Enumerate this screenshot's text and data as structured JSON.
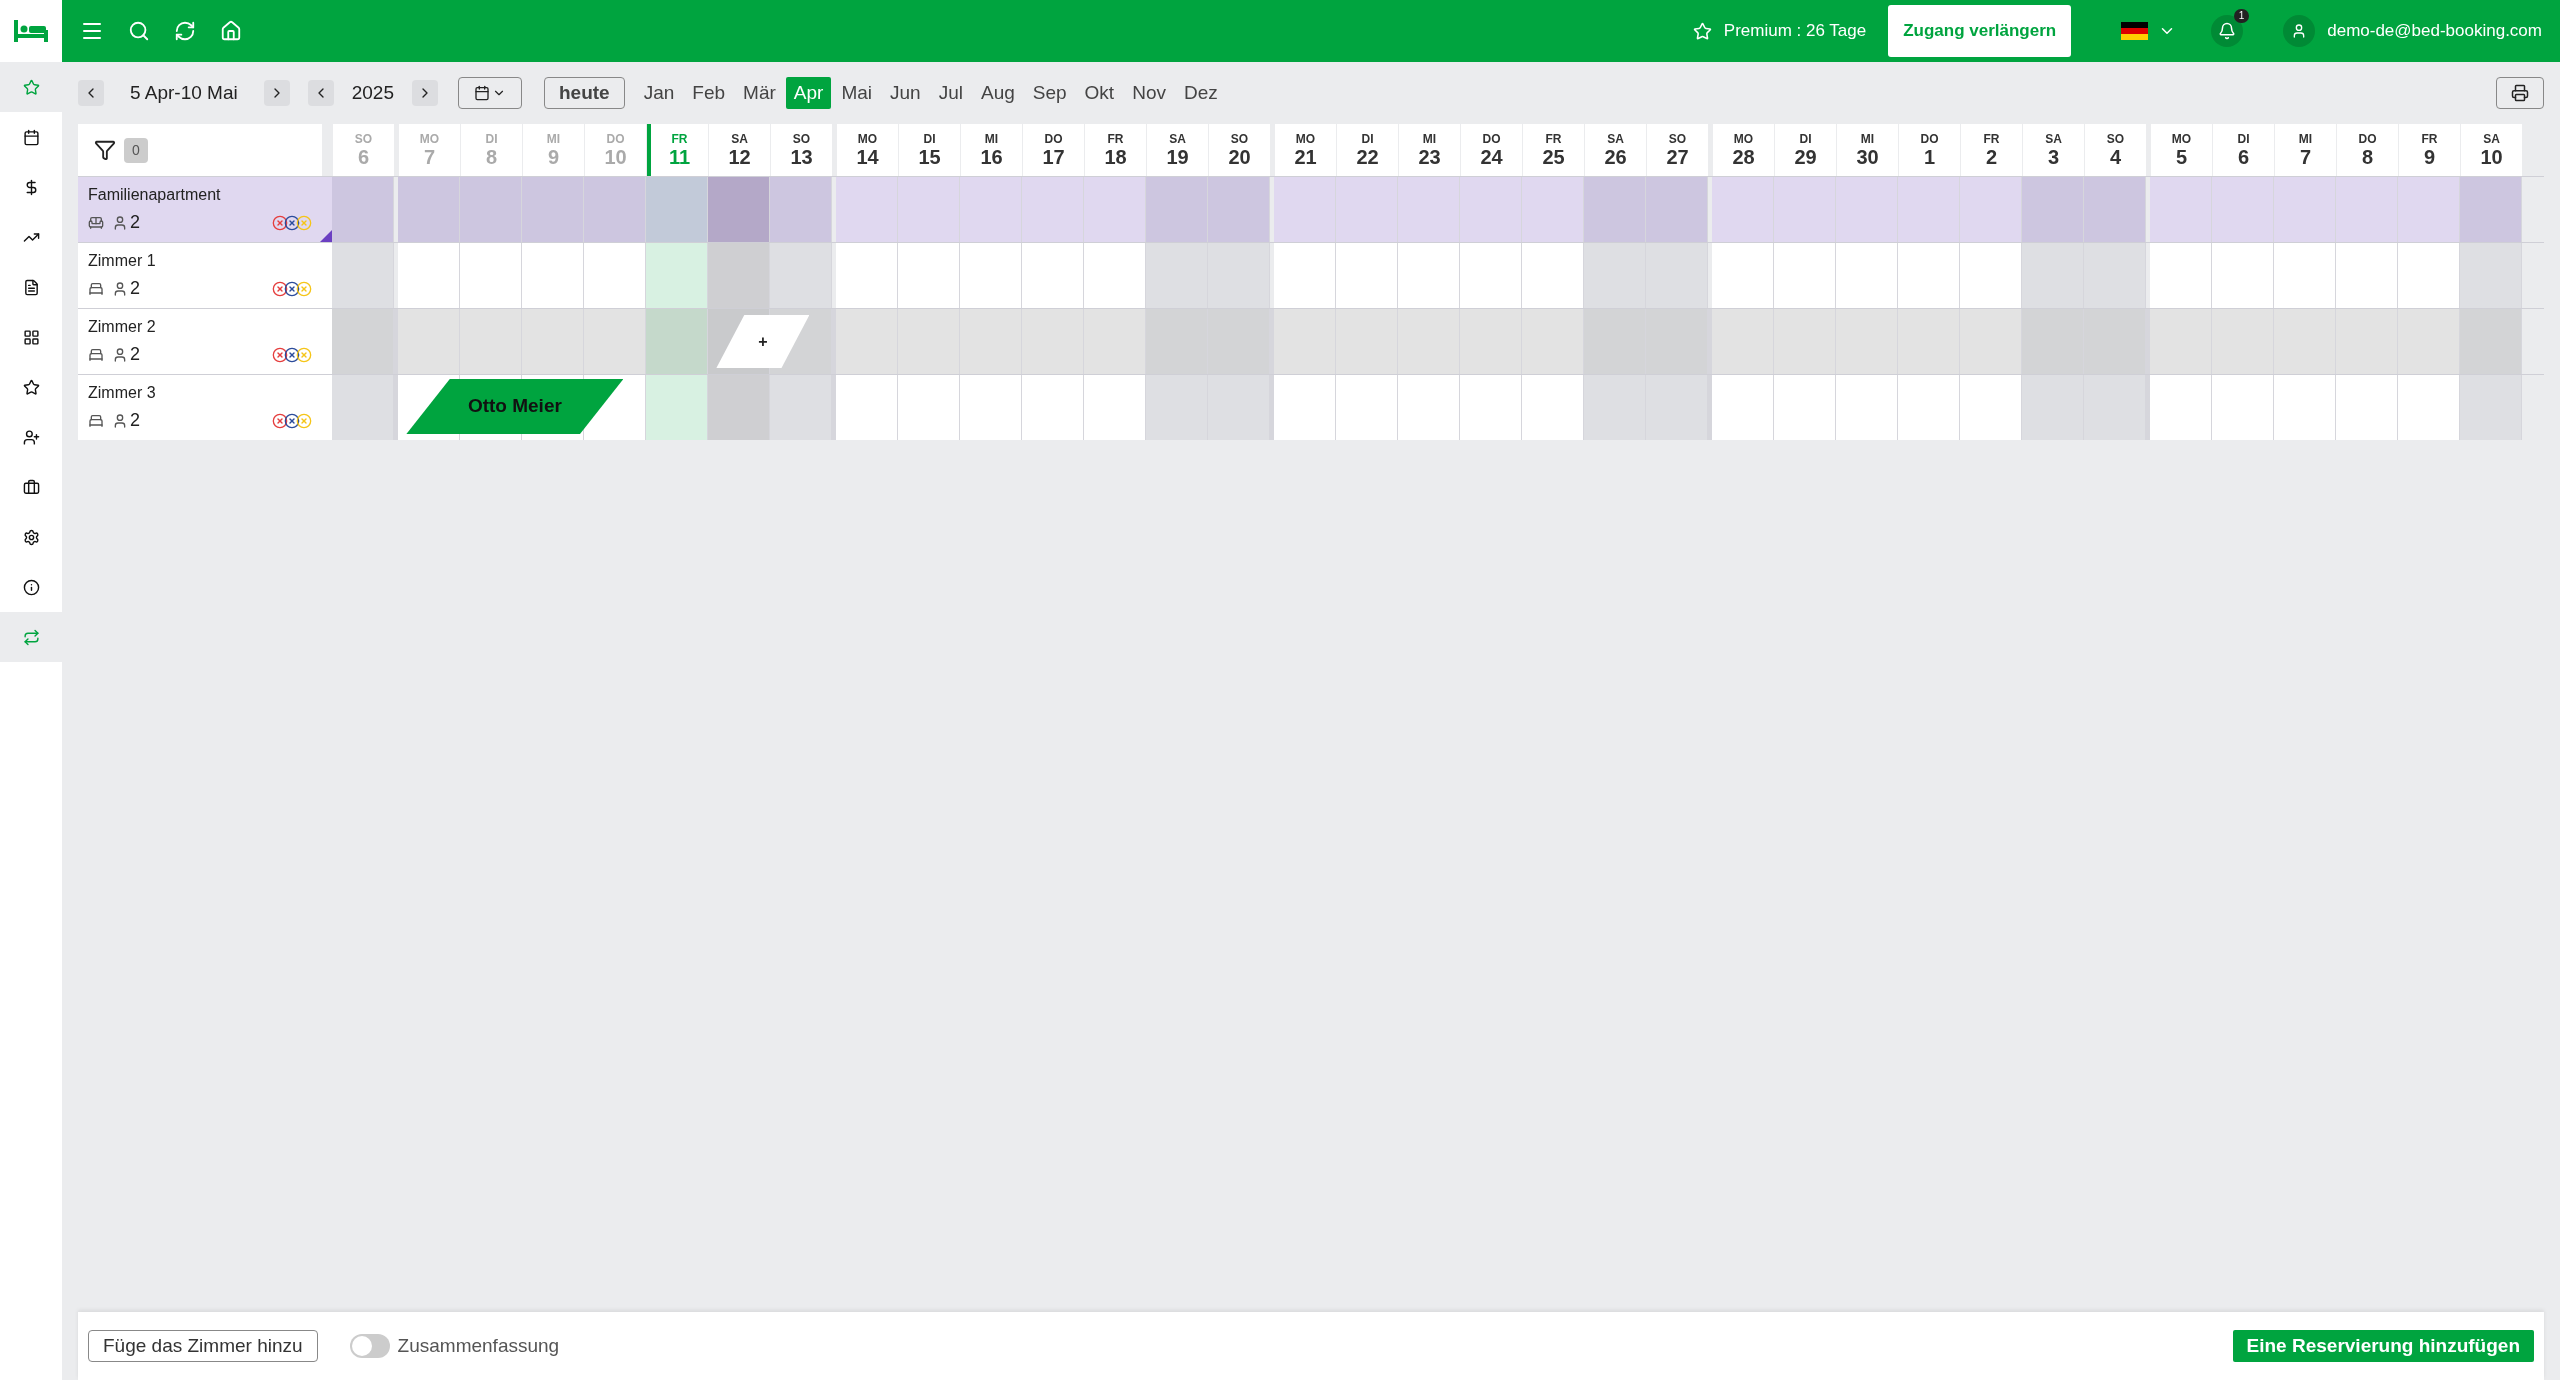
{
  "sidebar": {
    "items": [
      {
        "selected": true
      },
      {
        "selected": false
      },
      {
        "selected": false
      },
      {
        "selected": false
      },
      {
        "selected": false
      },
      {
        "selected": false
      },
      {
        "selected": false
      },
      {
        "selected": false
      },
      {
        "selected": false
      },
      {
        "selected": false
      },
      {
        "selected": false
      },
      {
        "selected": true
      }
    ]
  },
  "topbar": {
    "premium": "Premium : 26 Tage",
    "extend_button": "Zugang verlängern",
    "notifications": "1",
    "user": "demo-de@bed-booking.com"
  },
  "toolbar": {
    "range": "5 Apr-10 Mai",
    "year": "2025",
    "today_button": "heute",
    "months": [
      {
        "label": "Jan",
        "selected": false
      },
      {
        "label": "Feb",
        "selected": false
      },
      {
        "label": "Mär",
        "selected": false
      },
      {
        "label": "Apr",
        "selected": true
      },
      {
        "label": "Mai",
        "selected": false
      },
      {
        "label": "Jun",
        "selected": false
      },
      {
        "label": "Jul",
        "selected": false
      },
      {
        "label": "Aug",
        "selected": false
      },
      {
        "label": "Sep",
        "selected": false
      },
      {
        "label": "Okt",
        "selected": false
      },
      {
        "label": "Nov",
        "selected": false
      },
      {
        "label": "Dez",
        "selected": false
      }
    ]
  },
  "filter": {
    "count": "0"
  },
  "days": [
    {
      "dow": "SO",
      "day": "6",
      "weekend": true,
      "past": true,
      "today": false,
      "highlighted": false
    },
    {
      "dow": "MO",
      "day": "7",
      "weekend": false,
      "past": true,
      "today": false,
      "highlighted": false
    },
    {
      "dow": "DI",
      "day": "8",
      "weekend": false,
      "past": true,
      "today": false,
      "highlighted": false
    },
    {
      "dow": "MI",
      "day": "9",
      "weekend": false,
      "past": true,
      "today": false,
      "highlighted": false
    },
    {
      "dow": "DO",
      "day": "10",
      "weekend": false,
      "past": true,
      "today": false,
      "highlighted": false
    },
    {
      "dow": "FR",
      "day": "11",
      "weekend": false,
      "past": false,
      "today": true,
      "highlighted": false
    },
    {
      "dow": "SA",
      "day": "12",
      "weekend": true,
      "past": false,
      "today": false,
      "highlighted": true
    },
    {
      "dow": "SO",
      "day": "13",
      "weekend": true,
      "past": false,
      "today": false,
      "highlighted": false
    },
    {
      "dow": "MO",
      "day": "14",
      "weekend": false,
      "past": false,
      "today": false,
      "highlighted": false
    },
    {
      "dow": "DI",
      "day": "15",
      "weekend": false,
      "past": false,
      "today": false,
      "highlighted": false
    },
    {
      "dow": "MI",
      "day": "16",
      "weekend": false,
      "past": false,
      "today": false,
      "highlighted": false
    },
    {
      "dow": "DO",
      "day": "17",
      "weekend": false,
      "past": false,
      "today": false,
      "highlighted": false
    },
    {
      "dow": "FR",
      "day": "18",
      "weekend": false,
      "past": false,
      "today": false,
      "highlighted": false
    },
    {
      "dow": "SA",
      "day": "19",
      "weekend": true,
      "past": false,
      "today": false,
      "highlighted": false
    },
    {
      "dow": "SO",
      "day": "20",
      "weekend": true,
      "past": false,
      "today": false,
      "highlighted": false
    },
    {
      "dow": "MO",
      "day": "21",
      "weekend": false,
      "past": false,
      "today": false,
      "highlighted": false
    },
    {
      "dow": "DI",
      "day": "22",
      "weekend": false,
      "past": false,
      "today": false,
      "highlighted": false
    },
    {
      "dow": "MI",
      "day": "23",
      "weekend": false,
      "past": false,
      "today": false,
      "highlighted": false
    },
    {
      "dow": "DO",
      "day": "24",
      "weekend": false,
      "past": false,
      "today": false,
      "highlighted": false
    },
    {
      "dow": "FR",
      "day": "25",
      "weekend": false,
      "past": false,
      "today": false,
      "highlighted": false
    },
    {
      "dow": "SA",
      "day": "26",
      "weekend": true,
      "past": false,
      "today": false,
      "highlighted": false
    },
    {
      "dow": "SO",
      "day": "27",
      "weekend": true,
      "past": false,
      "today": false,
      "highlighted": false
    },
    {
      "dow": "MO",
      "day": "28",
      "weekend": false,
      "past": false,
      "today": false,
      "highlighted": false
    },
    {
      "dow": "DI",
      "day": "29",
      "weekend": false,
      "past": false,
      "today": false,
      "highlighted": false
    },
    {
      "dow": "MI",
      "day": "30",
      "weekend": false,
      "past": false,
      "today": false,
      "highlighted": false
    },
    {
      "dow": "DO",
      "day": "1",
      "weekend": false,
      "past": false,
      "today": false,
      "highlighted": false
    },
    {
      "dow": "FR",
      "day": "2",
      "weekend": false,
      "past": false,
      "today": false,
      "highlighted": false
    },
    {
      "dow": "SA",
      "day": "3",
      "weekend": true,
      "past": false,
      "today": false,
      "highlighted": false
    },
    {
      "dow": "SO",
      "day": "4",
      "weekend": true,
      "past": false,
      "today": false,
      "highlighted": false
    },
    {
      "dow": "MO",
      "day": "5",
      "weekend": false,
      "past": false,
      "today": false,
      "highlighted": false
    },
    {
      "dow": "DI",
      "day": "6",
      "weekend": false,
      "past": false,
      "today": false,
      "highlighted": false
    },
    {
      "dow": "MI",
      "day": "7",
      "weekend": false,
      "past": false,
      "today": false,
      "highlighted": false
    },
    {
      "dow": "DO",
      "day": "8",
      "weekend": false,
      "past": false,
      "today": false,
      "highlighted": false
    },
    {
      "dow": "FR",
      "day": "9",
      "weekend": false,
      "past": false,
      "today": false,
      "highlighted": false
    },
    {
      "dow": "SA",
      "day": "10",
      "weekend": true,
      "past": false,
      "today": false,
      "highlighted": false
    }
  ],
  "rooms": [
    {
      "name": "Familienapartment",
      "kind": "apartment",
      "guests": "2",
      "highlighted": false
    },
    {
      "name": "Zimmer 1",
      "kind": "room",
      "guests": "2",
      "highlighted": false
    },
    {
      "name": "Zimmer 2",
      "kind": "room",
      "guests": "2",
      "highlighted": true
    },
    {
      "name": "Zimmer 3",
      "kind": "room",
      "guests": "2",
      "highlighted": false
    }
  ],
  "bookings": [
    {
      "kind": "reservation",
      "label": "Otto Meier"
    },
    {
      "kind": "new",
      "label": "+"
    }
  ],
  "footer": {
    "add_room_button": "Füge das Zimmer hinzu",
    "summary": {
      "label": "Zusammenfassung",
      "on": false
    },
    "add_reservation_button": "Eine Reservierung hinzufügen"
  }
}
